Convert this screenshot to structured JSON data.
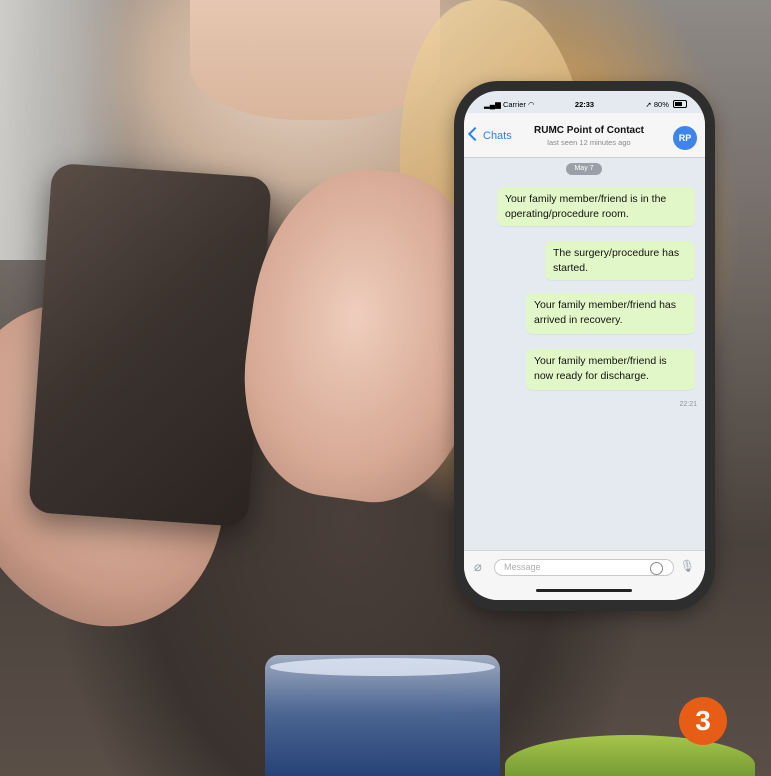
{
  "status_bar": {
    "carrier": "Carrier",
    "time": "22:33",
    "battery": "80%"
  },
  "nav": {
    "back_label": "Chats",
    "title": "RUMC Point of Contact",
    "subtitle": "last seen 12 minutes ago",
    "avatar_initials": "RP"
  },
  "chat": {
    "date": "May 7",
    "messages": [
      "Your family member/friend is in the operating/procedure room.",
      "The surgery/procedure has started.",
      "Your family member/friend has arrived in recovery.",
      "Your family member/friend is now ready for discharge."
    ],
    "last_time": "22:21"
  },
  "composer": {
    "placeholder": "Message"
  },
  "step_number": "3",
  "colors": {
    "accent": "#2f7ff4",
    "bubble": "#e2f7c8",
    "badge": "#e85d16",
    "avatar": "#3f84e8"
  }
}
